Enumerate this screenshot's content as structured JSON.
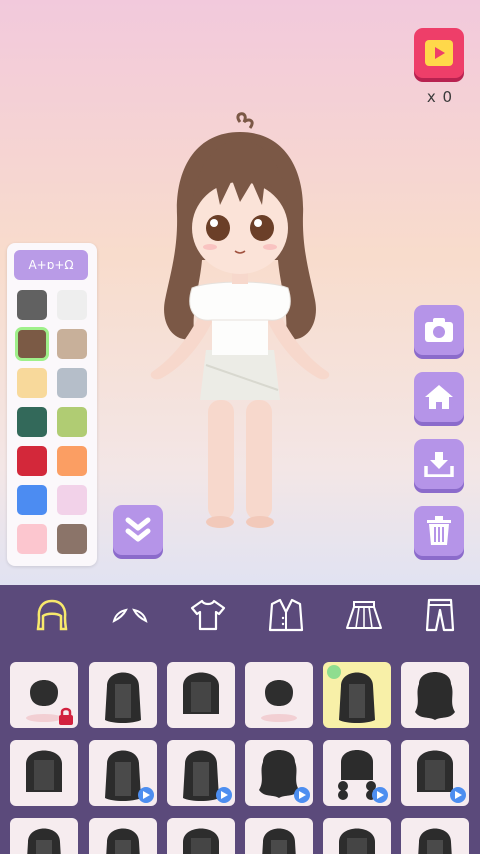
{
  "reward": {
    "icon": "video-reward-icon",
    "count_label": "x 0"
  },
  "palette": {
    "tab_label": "A+ɒ+Ω",
    "swatches": [
      "#616161",
      "#eeeeee",
      "#7b5a45",
      "#c8b09a",
      "#f8d99b",
      "#b5bec9",
      "#33695a",
      "#b0cc73",
      "#d3283a",
      "#fb9e63",
      "#4c8cf2",
      "#f2d2e9",
      "#fcc6cf",
      "#8b7469"
    ],
    "selected_index": 2
  },
  "side_buttons": [
    "camera-icon",
    "home-icon",
    "download-icon",
    "trash-icon"
  ],
  "categories": [
    "hair-icon",
    "eyebrows-icon",
    "tshirt-icon",
    "jacket-icon",
    "skirt-icon",
    "pants-icon"
  ],
  "selected_category": 0,
  "items": [
    {
      "style": "short",
      "badge": "lock"
    },
    {
      "style": "long",
      "badge": ""
    },
    {
      "style": "bob",
      "badge": ""
    },
    {
      "style": "short",
      "badge": ""
    },
    {
      "style": "long",
      "badge": "check",
      "selected": true
    },
    {
      "style": "wavy",
      "badge": ""
    },
    {
      "style": "bob",
      "badge": ""
    },
    {
      "style": "long",
      "badge": "video"
    },
    {
      "style": "long",
      "badge": "video"
    },
    {
      "style": "wavy",
      "badge": "video"
    },
    {
      "style": "braid",
      "badge": "video"
    },
    {
      "style": "bob",
      "badge": "video"
    },
    {
      "style": "long",
      "badge": ""
    },
    {
      "style": "long",
      "badge": ""
    },
    {
      "style": "bob",
      "badge": ""
    },
    {
      "style": "long",
      "badge": ""
    },
    {
      "style": "bob",
      "badge": ""
    },
    {
      "style": "long",
      "badge": ""
    }
  ]
}
